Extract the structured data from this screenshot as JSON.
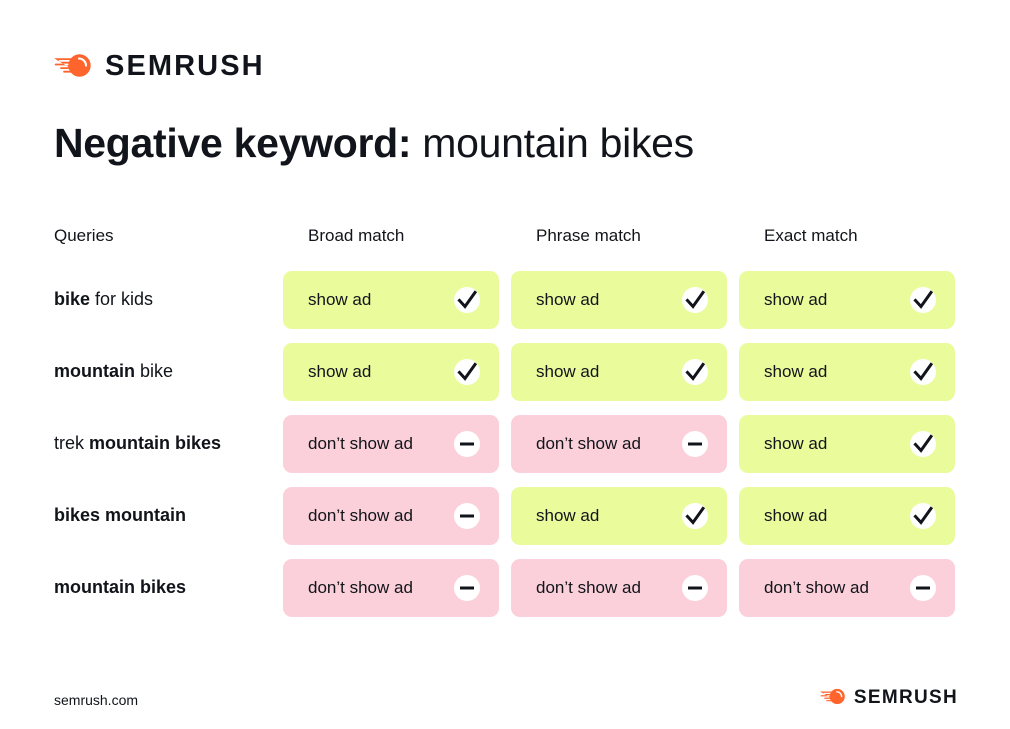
{
  "brand": {
    "name": "SEMRUSH",
    "logo_icon": "semrush-comet-icon",
    "orange": "#ff642d",
    "ink": "#11141a"
  },
  "title": {
    "strong": "Negative keyword:",
    "light": " mountain bikes"
  },
  "table": {
    "headers": {
      "queries": "Queries",
      "columns": [
        "Broad match",
        "Phrase match",
        "Exact match"
      ]
    },
    "labels": {
      "show": "show ad",
      "dont_show": "don’t show ad"
    },
    "icons": {
      "show": "check-icon",
      "dont_show": "minus-icon"
    },
    "colors": {
      "show": "#eafb9b",
      "dont_show": "#fbd0da"
    },
    "rows": [
      {
        "query_parts": [
          {
            "text": "bike",
            "bold": true
          },
          {
            "text": " for kids",
            "bold": false
          }
        ],
        "cells": [
          {
            "state": "show",
            "label": "show ad"
          },
          {
            "state": "show",
            "label": "show ad"
          },
          {
            "state": "show",
            "label": "show ad"
          }
        ]
      },
      {
        "query_parts": [
          {
            "text": "mountain",
            "bold": true
          },
          {
            "text": " bike",
            "bold": false
          }
        ],
        "cells": [
          {
            "state": "show",
            "label": "show ad"
          },
          {
            "state": "show",
            "label": "show ad"
          },
          {
            "state": "show",
            "label": "show ad"
          }
        ]
      },
      {
        "query_parts": [
          {
            "text": "trek ",
            "bold": false
          },
          {
            "text": "mountain bikes",
            "bold": true
          }
        ],
        "cells": [
          {
            "state": "dont_show",
            "label": "don’t show ad"
          },
          {
            "state": "dont_show",
            "label": "don’t show ad"
          },
          {
            "state": "show",
            "label": "show ad"
          }
        ]
      },
      {
        "query_parts": [
          {
            "text": "bikes mountain",
            "bold": true
          }
        ],
        "cells": [
          {
            "state": "dont_show",
            "label": "don’t show ad"
          },
          {
            "state": "show",
            "label": "show ad"
          },
          {
            "state": "show",
            "label": "show ad"
          }
        ]
      },
      {
        "query_parts": [
          {
            "text": "mountain bikes",
            "bold": true
          }
        ],
        "cells": [
          {
            "state": "dont_show",
            "label": "don’t show ad"
          },
          {
            "state": "dont_show",
            "label": "don’t show ad"
          },
          {
            "state": "dont_show",
            "label": "don’t show ad"
          }
        ]
      }
    ]
  },
  "footer": {
    "url": "semrush.com",
    "brand": "SEMRUSH"
  }
}
